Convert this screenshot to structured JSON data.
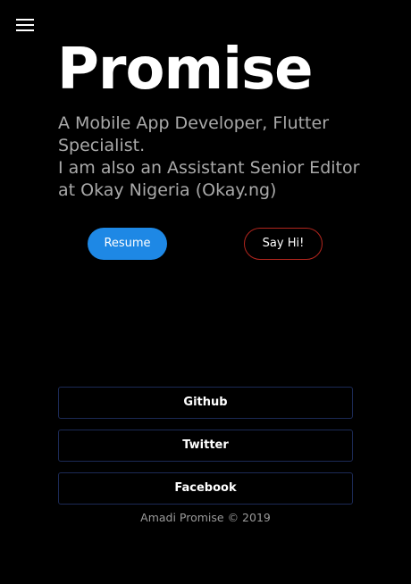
{
  "header": {
    "menu_icon": "hamburger-menu-icon"
  },
  "hero": {
    "title": "Promise",
    "tagline_line1": "A Mobile App Developer, Flutter Specialist.",
    "tagline_line2": "I am also an Assistant Senior Editor at Okay Nigeria (Okay.ng)"
  },
  "actions": {
    "resume_label": "Resume",
    "say_hi_label": "Say Hi!"
  },
  "social": {
    "github_label": "Github",
    "twitter_label": "Twitter",
    "facebook_label": "Facebook"
  },
  "footer": {
    "copyright": "Amadi Promise © 2019"
  },
  "colors": {
    "background": "#000000",
    "primary_button": "#1e88e5",
    "outline_button_border": "#b3261e",
    "social_border": "#1c2a56",
    "tagline_text": "#a9a9a9"
  }
}
